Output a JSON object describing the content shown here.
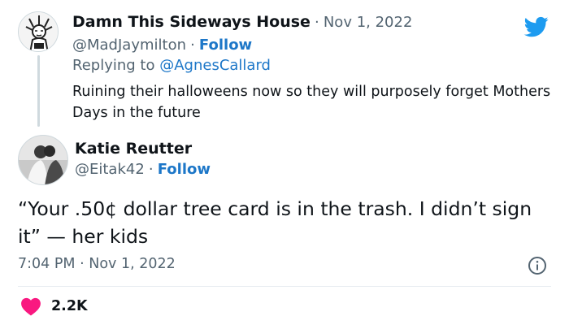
{
  "reply_tweet": {
    "author_name": "Damn This Sideways House",
    "date": "Nov 1, 2022",
    "handle": "@MadJaymilton",
    "follow_label": "Follow",
    "replying_prefix": "Replying to",
    "replying_to": "@AgnesCallard",
    "text": "Ruining their halloweens now so they will purposely forget Mothers Days in the future"
  },
  "main_tweet": {
    "author_name": "Katie Reutter",
    "handle": "@Eitak42",
    "follow_label": "Follow",
    "text": "“Your .50¢ dollar tree card is in the trash. I didn’t sign it” — her kids",
    "time": "7:04 PM",
    "date": "Nov 1, 2022",
    "like_count": "2.2K"
  },
  "separator": "·",
  "icons": {
    "brand": "twitter-bird-icon",
    "info": "info-icon",
    "like": "heart-icon"
  },
  "colors": {
    "brand_blue": "#1d9bf0",
    "link_blue": "#1d77c8",
    "like_red": "#f91880",
    "muted_gray": "#536471"
  }
}
